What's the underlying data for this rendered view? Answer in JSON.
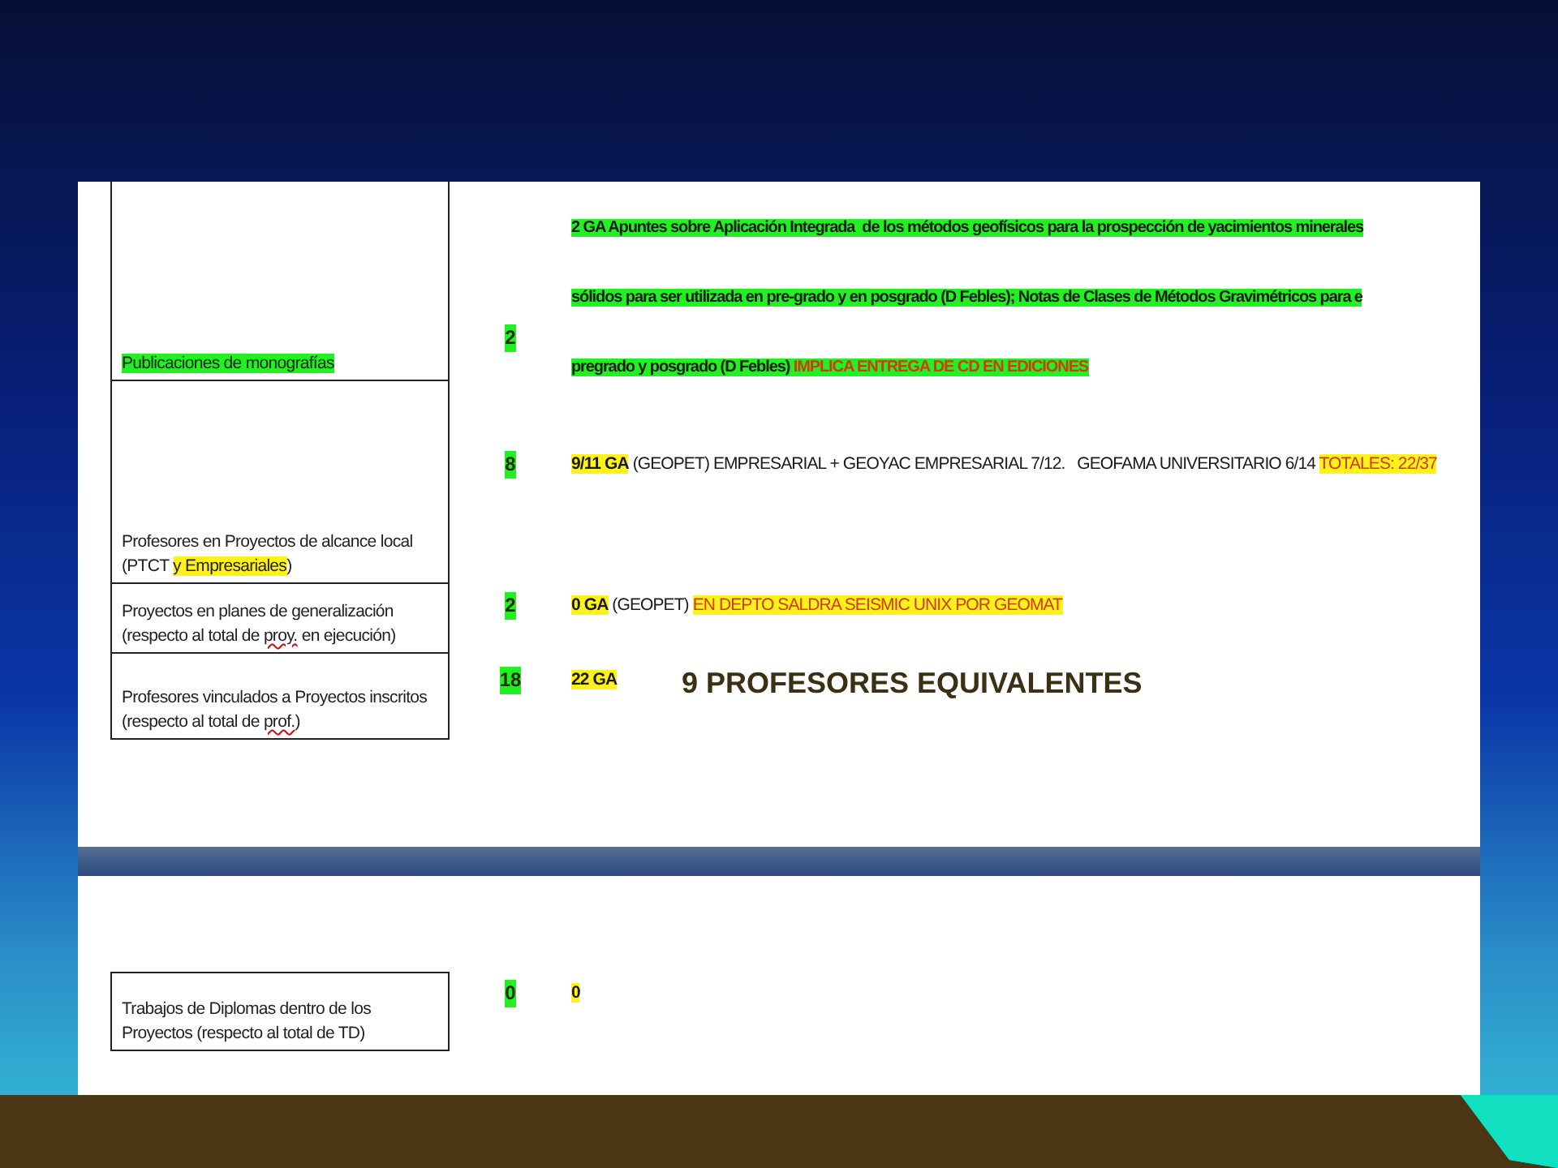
{
  "slide": {
    "rows": [
      {
        "label": [
          {
            "text": "Publicaciones de monografías",
            "kind": "green"
          }
        ],
        "count": {
          "text": "2",
          "kind": "green"
        },
        "lines": [
          [
            {
              "text": "2 GA Apuntes sobre Aplicación Integrada  de los métodos geofísicos para la prospección de yacimientos minerales",
              "kind": "green"
            }
          ],
          [
            {
              "text": "sólidos para ser utilizada en pre-grado y en posgrado (D Febles); Notas de Clases de Métodos Gravimétricos para e",
              "kind": "green"
            }
          ],
          [
            {
              "text": "pregrado y posgrado (D Febles)",
              "kind": "green"
            },
            {
              "text": " IMPLICA ENTREGA DE CD EN EDICIONES",
              "kind": "alert-green"
            }
          ]
        ]
      },
      {
        "label": [
          {
            "text": "Profesores en Proyectos de alcance local (PTCT ",
            "kind": "plain"
          },
          {
            "text": "y Empresariales",
            "kind": "yellow"
          },
          {
            "text": ")",
            "kind": "plain"
          }
        ],
        "count": {
          "text": "8",
          "kind": "green"
        },
        "lines": [
          [
            {
              "text": "9/11 GA",
              "kind": "yellow"
            },
            {
              "text": " (GEOPET) EMPRESARIAL + GEOYAC EMPRESARIAL 7/12.   GEOFAMA UNIVERSITARIO 6/14 ",
              "kind": "plain"
            },
            {
              "text": "TOTALES: 22/37",
              "kind": "alert-yellow"
            }
          ]
        ]
      },
      {
        "label": [
          {
            "text": "Proyectos en planes de generalización (respecto al total de ",
            "kind": "plain"
          },
          {
            "text": "proy.",
            "kind": "misspelled"
          },
          {
            "text": " en ejecución)",
            "kind": "plain"
          }
        ],
        "count": {
          "text": "2",
          "kind": "green"
        },
        "lines": [
          [
            {
              "text": "0 GA",
              "kind": "yellow"
            },
            {
              "text": " (GEOPET) ",
              "kind": "plain"
            },
            {
              "text": "EN DEPTO SALDRA SEISMIC UNIX POR GEOMAT",
              "kind": "alert-yellow"
            }
          ]
        ]
      },
      {
        "label": [
          {
            "text": "Profesores vinculados a Proyectos inscritos (respecto al total de ",
            "kind": "plain"
          },
          {
            "text": "prof.",
            "kind": "misspelled"
          },
          {
            "text": ")",
            "kind": "plain"
          }
        ],
        "count": {
          "text": "18",
          "kind": "green"
        },
        "lines": [
          [
            {
              "text": "22 GA",
              "kind": "yellow"
            }
          ]
        ],
        "note": "9 PROFESORES EQUIVALENTES"
      }
    ],
    "lower_rows": [
      {
        "label": [
          {
            "text": "Trabajos de Diplomas dentro de los Proyectos (respecto al total de TD)",
            "kind": "plain"
          }
        ],
        "count": {
          "text": "0",
          "kind": "green"
        },
        "lines": [
          [
            {
              "text": "0",
              "kind": "yellow"
            }
          ]
        ]
      }
    ]
  }
}
